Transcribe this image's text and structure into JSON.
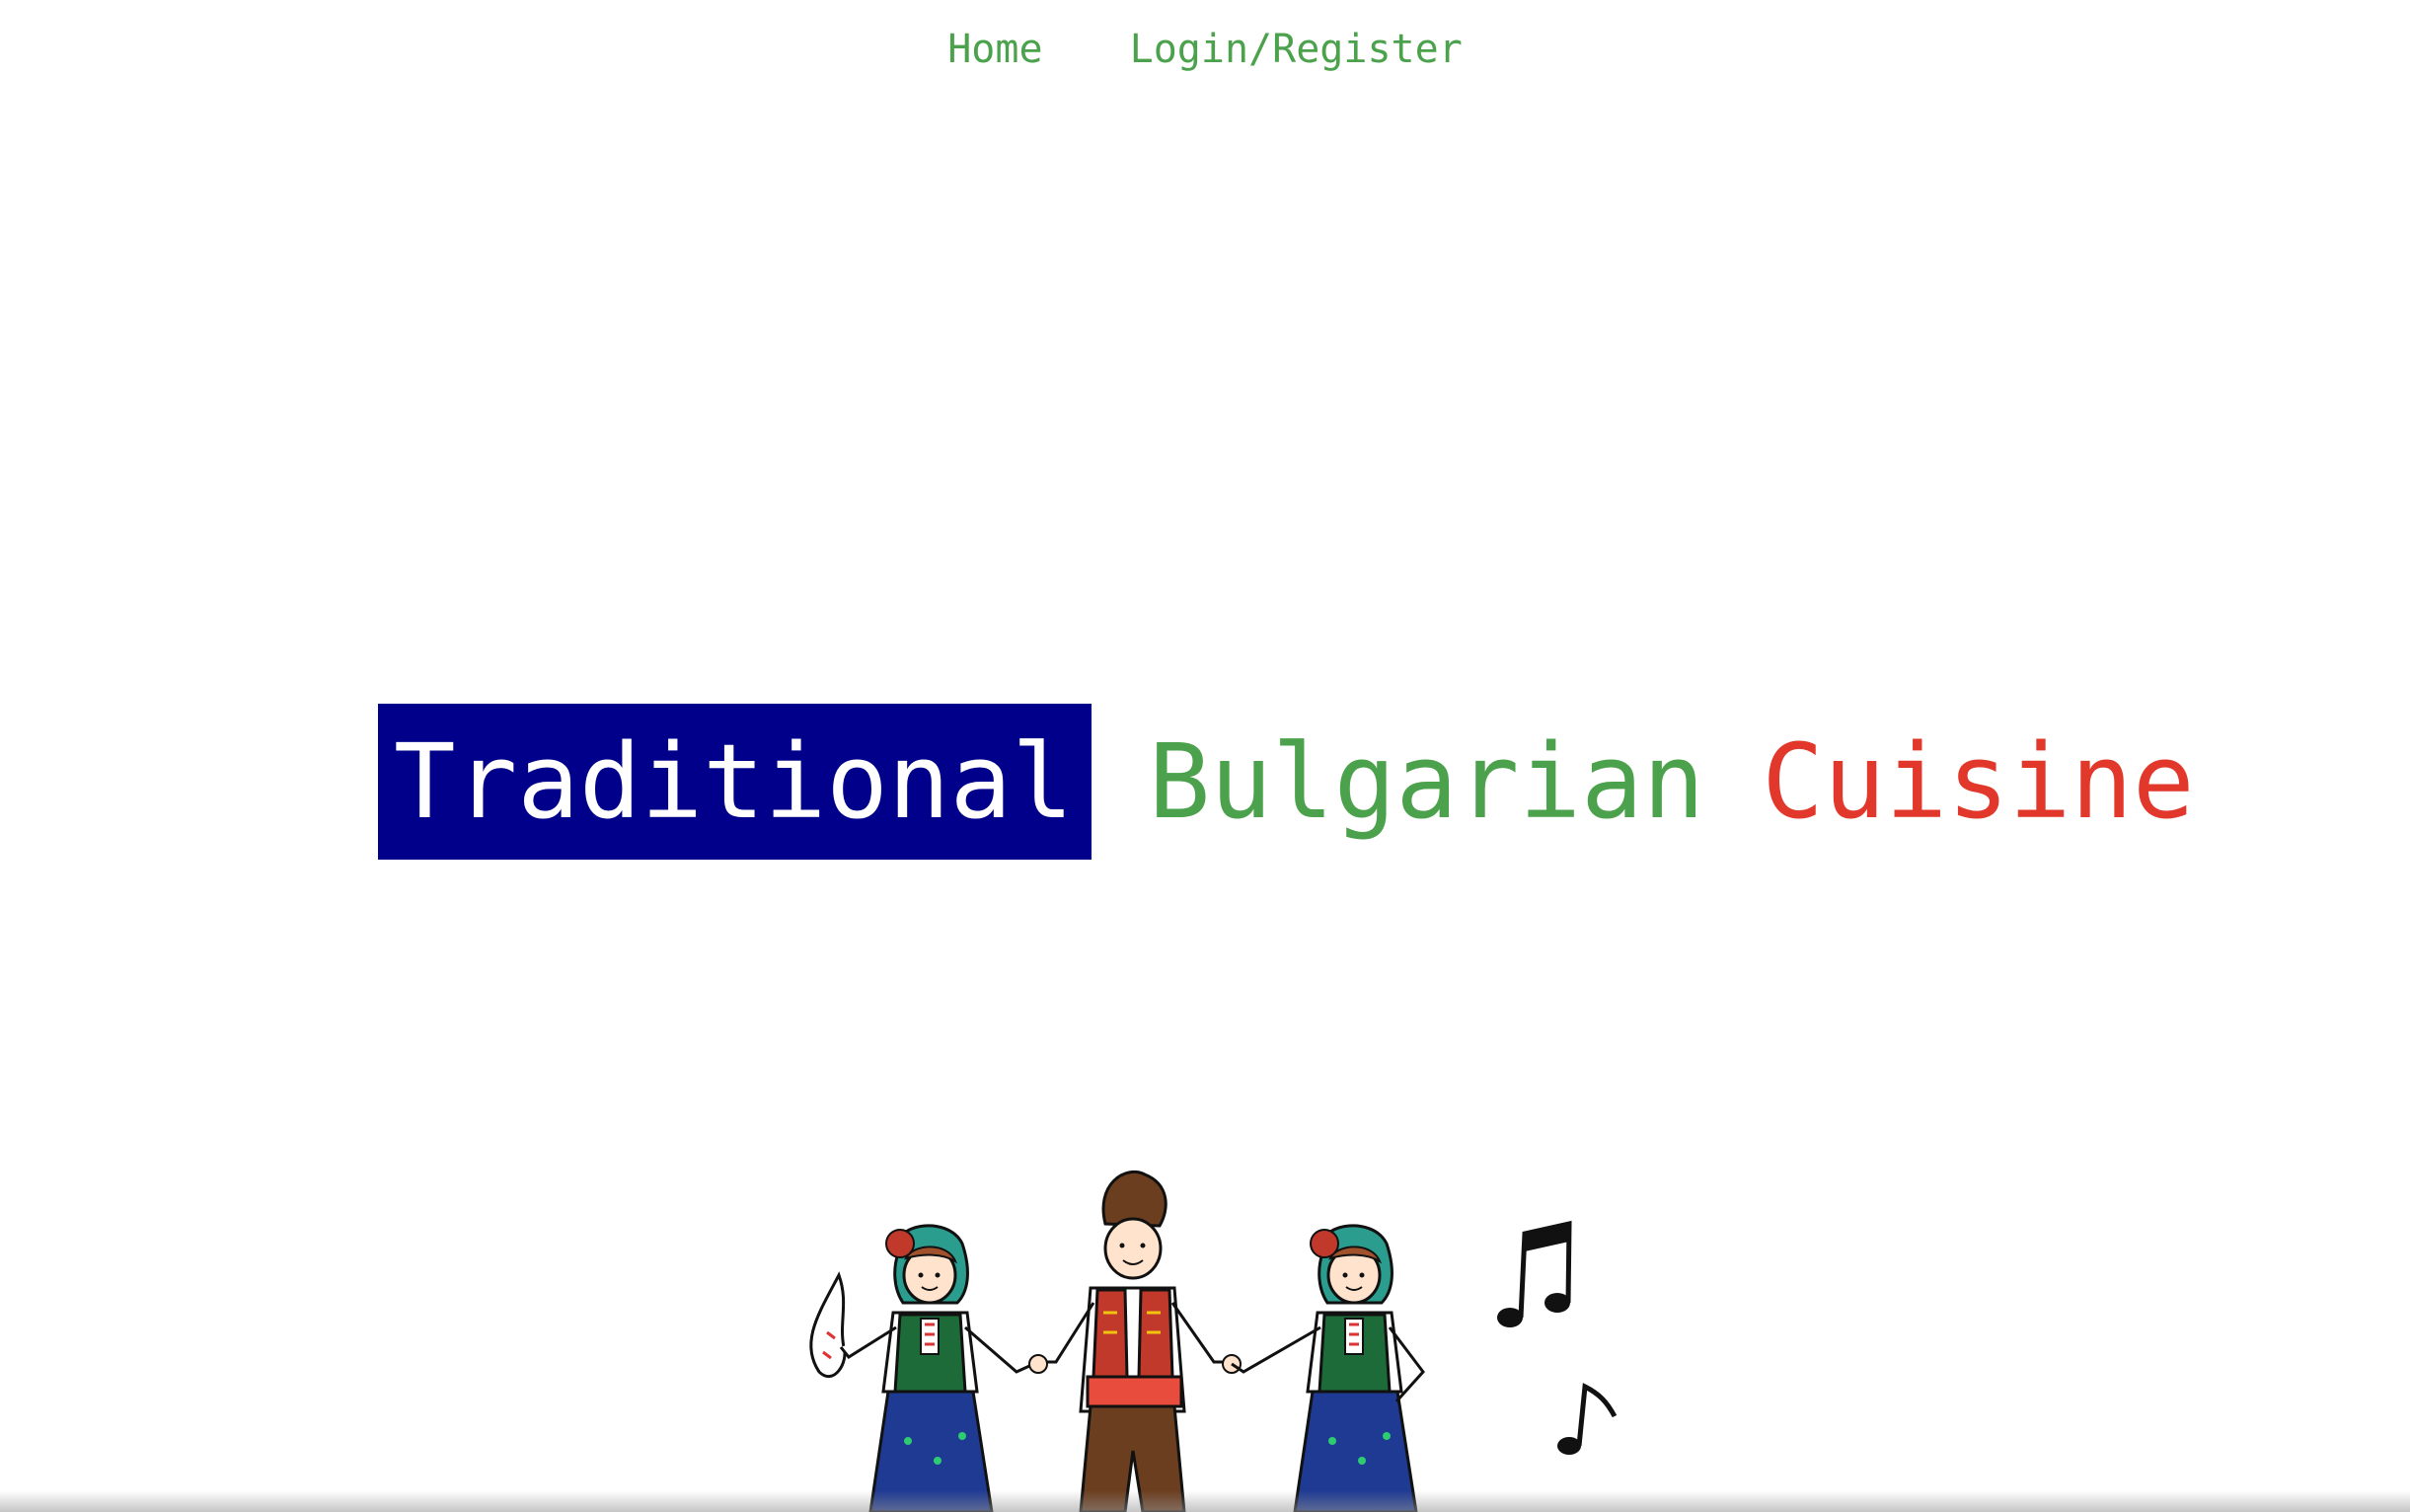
{
  "nav": {
    "home_label": "Home",
    "login_register_label": "Login/Register"
  },
  "hero": {
    "word1": "Traditional",
    "word2": "Bulgarian",
    "word3": "Cuisine"
  },
  "colors": {
    "nav_link": "#4ca24c",
    "flag_blue": "#00008b",
    "flag_green": "#4ca24c",
    "flag_red": "#e2382b",
    "background": "#ffffff"
  },
  "illustration": {
    "subject": "folk-dancers-icon"
  }
}
